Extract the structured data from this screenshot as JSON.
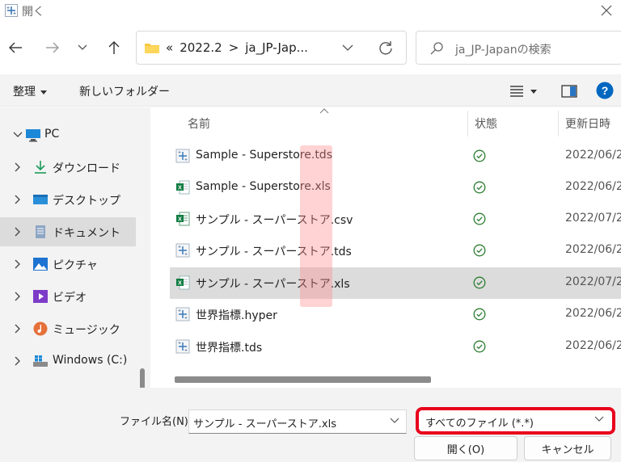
{
  "window": {
    "title": "開く"
  },
  "address": {
    "crumbs": [
      "«",
      "2022.2",
      ">",
      "ja_JP-Jap..."
    ]
  },
  "search": {
    "placeholder": "ja_JP-Japanの検索"
  },
  "toolbar": {
    "organize": "整理",
    "new_folder": "新しいフォルダー"
  },
  "sidebar": {
    "items": [
      {
        "label": "PC",
        "icon": "pc-icon",
        "expanded": true,
        "selected": false
      },
      {
        "label": "ダウンロード",
        "icon": "download-icon",
        "expanded": false,
        "selected": false
      },
      {
        "label": "デスクトップ",
        "icon": "desktop-icon",
        "expanded": false,
        "selected": false
      },
      {
        "label": "ドキュメント",
        "icon": "documents-icon",
        "expanded": false,
        "selected": true
      },
      {
        "label": "ピクチャ",
        "icon": "pictures-icon",
        "expanded": false,
        "selected": false
      },
      {
        "label": "ビデオ",
        "icon": "videos-icon",
        "expanded": false,
        "selected": false
      },
      {
        "label": "ミュージック",
        "icon": "music-icon",
        "expanded": false,
        "selected": false
      },
      {
        "label": "Windows (C:)",
        "icon": "drive-icon",
        "expanded": false,
        "selected": false
      }
    ]
  },
  "columns": {
    "name": "名前",
    "status": "状態",
    "date": "更新日時"
  },
  "files": [
    {
      "name": "Sample - Superstore.tds",
      "date": "2022/06/2",
      "type": "tds",
      "selected": false
    },
    {
      "name": "Sample - Superstore.xls",
      "date": "2022/06/2",
      "type": "xls",
      "selected": false
    },
    {
      "name": "サンプル - スーパーストア.csv",
      "date": "2022/07/2",
      "type": "csv",
      "selected": false
    },
    {
      "name": "サンプル - スーパーストア.tds",
      "date": "2022/06/2",
      "type": "tds",
      "selected": false
    },
    {
      "name": "サンプル - スーパーストア.xls",
      "date": "2022/07/2",
      "type": "xls",
      "selected": true
    },
    {
      "name": "世界指標.hyper",
      "date": "2022/06/2",
      "type": "hyper",
      "selected": false
    },
    {
      "name": "世界指標.tds",
      "date": "2022/06/2",
      "type": "tds",
      "selected": false
    }
  ],
  "footer": {
    "filename_label": "ファイル名(N):",
    "filename_value": "サンプル - スーパーストア.xls",
    "filetype_value": "すべてのファイル (*.*)",
    "open_button": "開く(O)",
    "cancel_button": "キャンセル"
  },
  "colors": {
    "accent": "#0067c0",
    "highlight_red": "#e8001c",
    "excel_green": "#107c41"
  }
}
